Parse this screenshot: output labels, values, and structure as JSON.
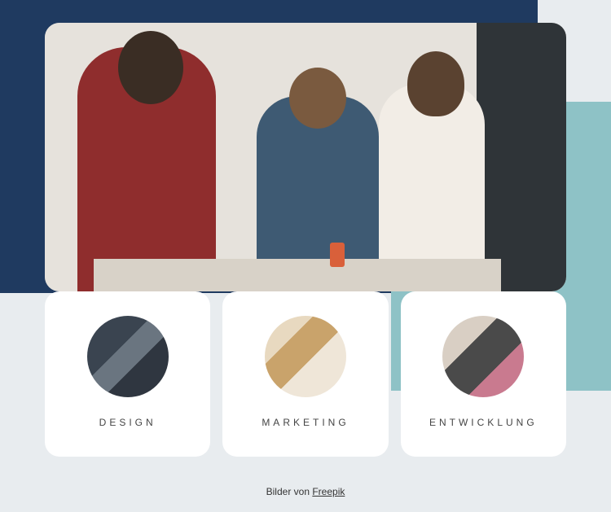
{
  "cards": [
    {
      "title": "DESIGN",
      "name": "card-design"
    },
    {
      "title": "MARKETING",
      "name": "card-marketing"
    },
    {
      "title": "ENTWICKLUNG",
      "name": "card-entwicklung"
    }
  ],
  "credit": {
    "prefix": "Bilder von ",
    "link_text": "Freepik"
  }
}
